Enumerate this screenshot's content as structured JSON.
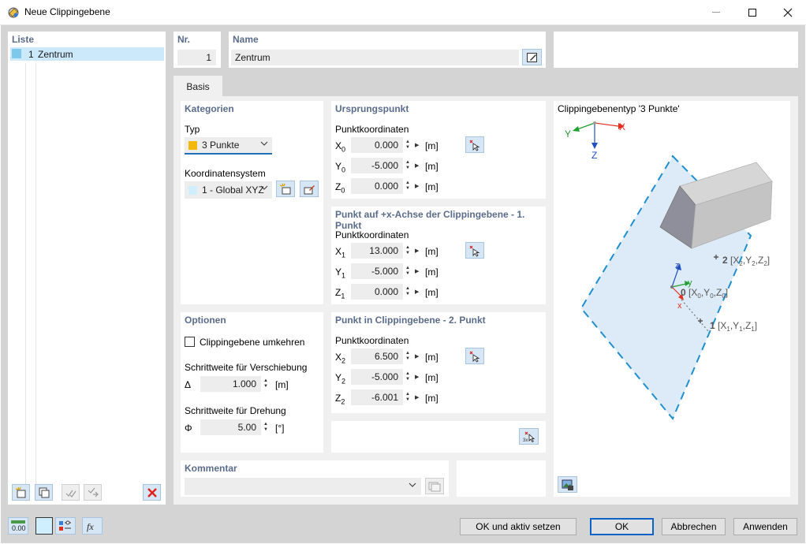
{
  "window": {
    "title": "Neue Clippingebene",
    "controls": {
      "minimize": "—",
      "maximize": "☐",
      "close": "✕"
    }
  },
  "list": {
    "title": "Liste",
    "items": [
      {
        "number": "1",
        "label": "Zentrum",
        "color": "#7ec8ec"
      }
    ]
  },
  "header": {
    "nr_label": "Nr.",
    "nr_value": "1",
    "name_label": "Name",
    "name_value": "Zentrum"
  },
  "tabs": [
    {
      "label": "Basis",
      "active": true
    }
  ],
  "categories": {
    "title": "Kategorien",
    "typ_label": "Typ",
    "typ_value": "3 Punkte",
    "typ_color": "#f2b90c",
    "cs_label": "Koordinatensystem",
    "cs_value": "1 - Global XYZ",
    "cs_color": "#cfefff"
  },
  "origin": {
    "title": "Ursprungspunkt",
    "subtitle": "Punktkoordinaten",
    "rows": [
      {
        "axis": "X",
        "sub": "0",
        "value": "0.000",
        "unit": "[m]"
      },
      {
        "axis": "Y",
        "sub": "0",
        "value": "-5.000",
        "unit": "[m]"
      },
      {
        "axis": "Z",
        "sub": "0",
        "value": "0.000",
        "unit": "[m]"
      }
    ]
  },
  "point1": {
    "title": "Punkt auf +x-Achse der Clippingebene - 1. Punkt",
    "subtitle": "Punktkoordinaten",
    "rows": [
      {
        "axis": "X",
        "sub": "1",
        "value": "13.000",
        "unit": "[m]"
      },
      {
        "axis": "Y",
        "sub": "1",
        "value": "-5.000",
        "unit": "[m]"
      },
      {
        "axis": "Z",
        "sub": "1",
        "value": "0.000",
        "unit": "[m]"
      }
    ]
  },
  "point2": {
    "title": "Punkt in Clippingebene - 2. Punkt",
    "subtitle": "Punktkoordinaten",
    "rows": [
      {
        "axis": "X",
        "sub": "2",
        "value": "6.500",
        "unit": "[m]"
      },
      {
        "axis": "Y",
        "sub": "2",
        "value": "-5.000",
        "unit": "[m]"
      },
      {
        "axis": "Z",
        "sub": "2",
        "value": "-6.001",
        "unit": "[m]"
      }
    ]
  },
  "options": {
    "title": "Optionen",
    "invert_label": "Clippingebene umkehren",
    "invert_checked": false,
    "shift_label": "Schrittweite für Verschiebung",
    "shift_symbol": "Δ",
    "shift_value": "1.000",
    "shift_unit": "[m]",
    "rot_label": "Schrittweite für Drehung",
    "rot_symbol": "Φ",
    "rot_value": "5.00",
    "rot_unit": "[°]"
  },
  "comment": {
    "title": "Kommentar",
    "value": ""
  },
  "preview": {
    "title": "Clippingebenentyp '3 Punkte'",
    "axis_x": "X",
    "axis_y": "Y",
    "axis_z": "Z",
    "local_x": "x",
    "local_y": "y",
    "local_z": "z",
    "p0_num": "0",
    "p1_num": "1",
    "p2_num": "2",
    "xyz_letters": [
      "X",
      "Y",
      "Z"
    ],
    "color_plane_fill": "#dcebf7",
    "color_plane_edge": "#1f8fcf"
  },
  "buttons": {
    "ok_active": "OK und aktiv setzen",
    "ok": "OK",
    "cancel": "Abbrechen",
    "apply": "Anwenden"
  }
}
